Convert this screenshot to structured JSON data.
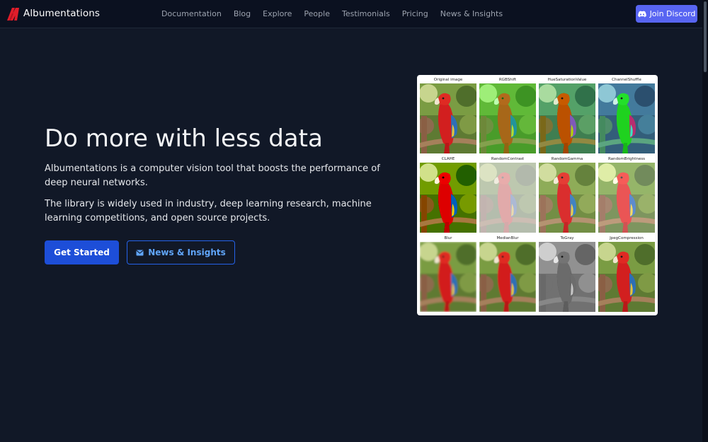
{
  "brand": {
    "name": "Albumentations",
    "logo_icon": "albumentations-logo-icon"
  },
  "nav": {
    "links": [
      "Documentation",
      "Blog",
      "Explore",
      "People",
      "Testimonials",
      "Pricing",
      "News & Insights"
    ],
    "discord_label": "Join Discord",
    "discord_icon": "discord-icon"
  },
  "hero": {
    "title": "Do more with less data",
    "paragraph1": "Albumentations is a computer vision tool that boosts the performance of deep neural networks.",
    "paragraph2": "The library is widely used in industry, deep learning research, machine learning competitions, and open source projects.",
    "primary_button": "Get Started",
    "secondary_button": "News & Insights",
    "secondary_icon": "envelope-icon"
  },
  "augmentations": [
    {
      "label": "Original image",
      "filter": "none"
    },
    {
      "label": "RGBShift",
      "filter": "rgbshift"
    },
    {
      "label": "HueSaturationValue",
      "filter": "hue"
    },
    {
      "label": "ChannelShuffle",
      "filter": "shuffle"
    },
    {
      "label": "CLAHE",
      "filter": "clahe"
    },
    {
      "label": "RandomContrast",
      "filter": "contrast"
    },
    {
      "label": "RandomGamma",
      "filter": "gamma"
    },
    {
      "label": "RandomBrightness",
      "filter": "bright"
    },
    {
      "label": "Blur",
      "filter": "blur"
    },
    {
      "label": "MedianBlur",
      "filter": "median"
    },
    {
      "label": "ToGray",
      "filter": "gray"
    },
    {
      "label": "JpegCompression",
      "filter": "none"
    }
  ],
  "colors": {
    "background": "#111827",
    "navbar": "#0b1120",
    "accent": "#1d4ed8",
    "discord": "#5865f2",
    "link": "#60a5fa"
  }
}
